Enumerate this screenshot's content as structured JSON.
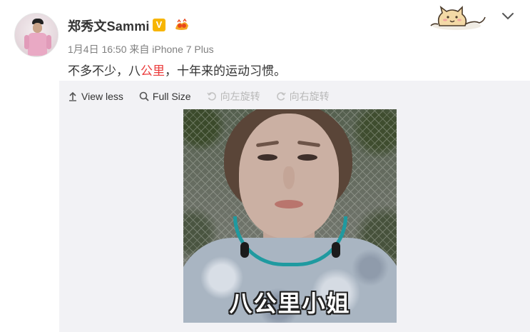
{
  "post": {
    "username": "郑秀文Sammi",
    "verified_badge": "V",
    "meta": "1月4日 16:50 来自 iPhone 7 Plus",
    "text_before": "不多不少，八",
    "text_highlight": "公里",
    "text_after": "，十年来的运动习惯。",
    "highlight_color": "#eb3b3b"
  },
  "media_toolbar": {
    "view_less": "View less",
    "full_size": "Full Size",
    "rotate_left": "向左旋转",
    "rotate_right": "向右旋转"
  },
  "photo": {
    "caption": "八公里小姐"
  },
  "icons": {
    "verified": "verified-v-badge",
    "level": "level-badge-icon",
    "sticker": "dog-sticker-icon",
    "menu": "chevron-down-icon",
    "view_less": "arrow-up-icon",
    "full_size": "magnifier-icon",
    "rotate_left": "rotate-left-icon",
    "rotate_right": "rotate-right-icon"
  }
}
